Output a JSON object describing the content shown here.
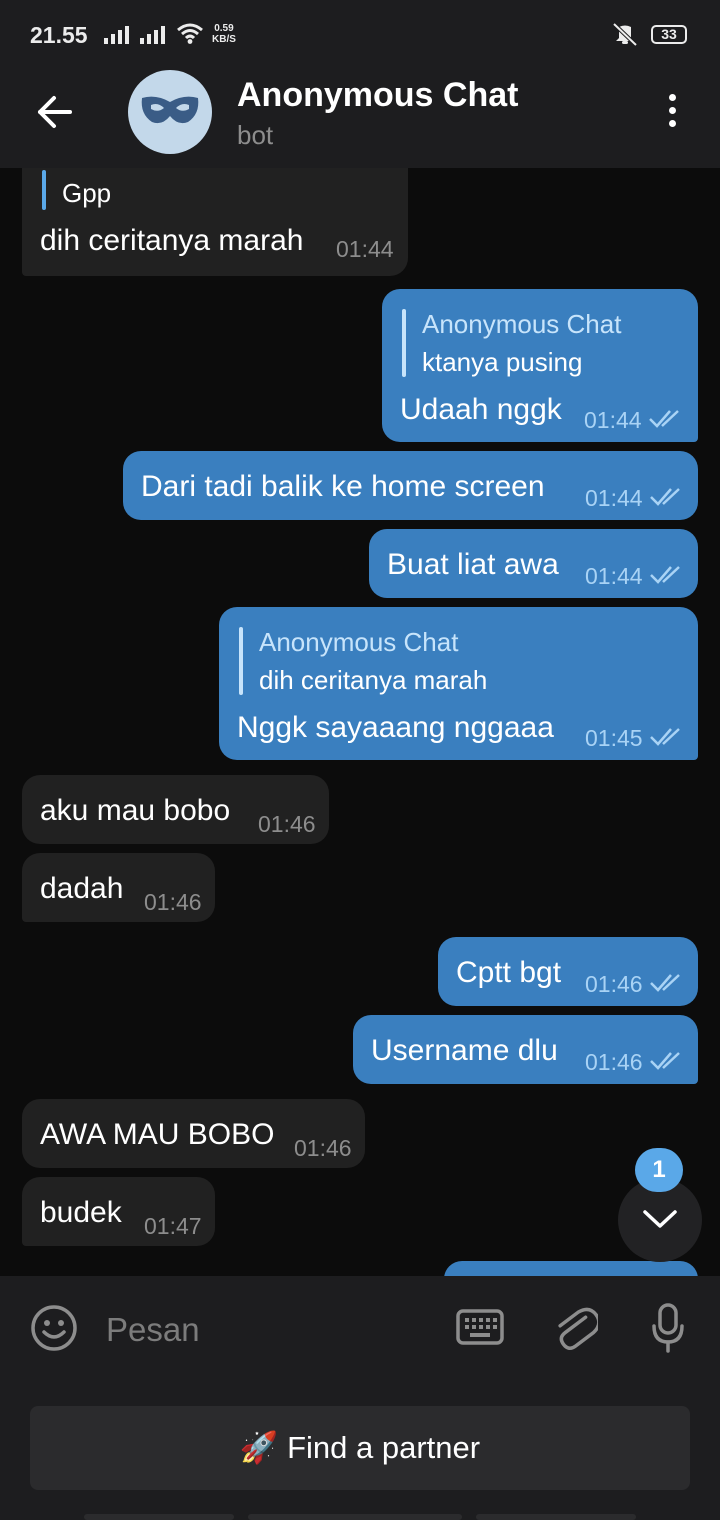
{
  "status_bar": {
    "time": "21.55",
    "net_speed_value": "0.59",
    "net_speed_unit": "KB/S",
    "battery": "33"
  },
  "header": {
    "title": "Anonymous Chat",
    "subtitle": "bot",
    "avatar_icon": "mask-icon",
    "avatar_bg": "#c3d8ea"
  },
  "colors": {
    "background": "#0c0c0c",
    "incoming_bubble": "#212121",
    "outgoing_bubble": "#3a7fbf",
    "accent": "#5aa8e8"
  },
  "messages": [
    {
      "direction": "in",
      "reply_text": "Gpp",
      "text": "dih ceritanya marah",
      "time": "01:44"
    },
    {
      "direction": "out",
      "reply_name": "Anonymous Chat",
      "reply_text": "ktanya pusing",
      "text": "Udaah nggk",
      "time": "01:44",
      "status": "read"
    },
    {
      "direction": "out",
      "text": "Dari tadi balik ke home screen",
      "time": "01:44",
      "status": "read"
    },
    {
      "direction": "out",
      "text": "Buat liat awa",
      "time": "01:44",
      "status": "read"
    },
    {
      "direction": "out",
      "reply_name": "Anonymous Chat",
      "reply_text": "dih ceritanya marah",
      "text": "Nggk sayaaang nggaaa",
      "time": "01:45",
      "status": "read"
    },
    {
      "direction": "in",
      "text": "aku mau bobo",
      "time": "01:46"
    },
    {
      "direction": "in",
      "text": "dadah",
      "time": "01:46"
    },
    {
      "direction": "out",
      "text": "Cptt bgt",
      "time": "01:46",
      "status": "read"
    },
    {
      "direction": "out",
      "text": "Username dlu",
      "time": "01:46",
      "status": "read"
    },
    {
      "direction": "in",
      "text": "AWA MAU BOBO",
      "time": "01:46"
    },
    {
      "direction": "in",
      "text": "budek",
      "time": "01:47"
    }
  ],
  "scroll_button": {
    "unread_count": "1"
  },
  "input": {
    "placeholder": "Pesan"
  },
  "bot_keyboard": {
    "button_label": "🚀 Find a partner"
  }
}
